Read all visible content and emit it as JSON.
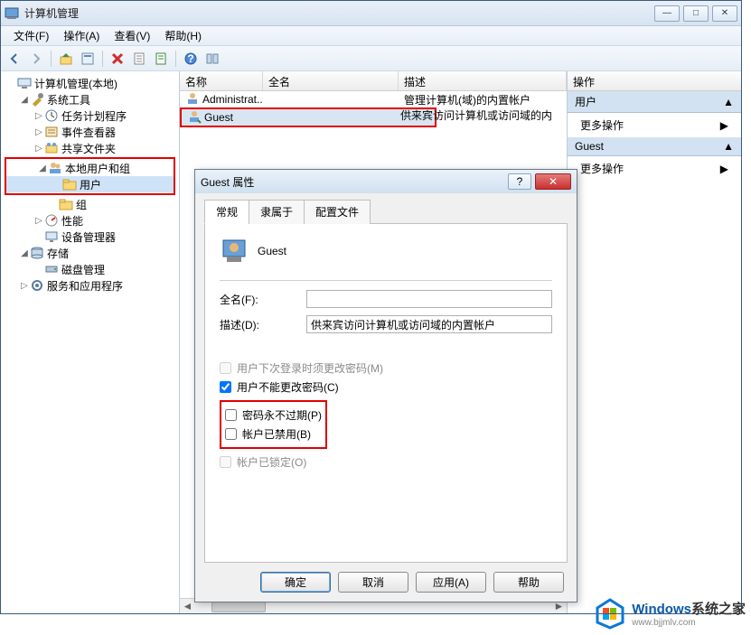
{
  "window": {
    "title": "计算机管理"
  },
  "menu": {
    "file": "文件(F)",
    "action": "操作(A)",
    "view": "查看(V)",
    "help": "帮助(H)"
  },
  "tree": {
    "root": "计算机管理(本地)",
    "sys_tools": "系统工具",
    "task_scheduler": "任务计划程序",
    "event_viewer": "事件查看器",
    "shared_folders": "共享文件夹",
    "local_users_groups": "本地用户和组",
    "users": "用户",
    "groups": "组",
    "performance": "性能",
    "device_manager": "设备管理器",
    "storage": "存储",
    "disk_mgmt": "磁盘管理",
    "services_apps": "服务和应用程序"
  },
  "list": {
    "col_name": "名称",
    "col_fullname": "全名",
    "col_desc": "描述",
    "rows": [
      {
        "name": "Administrat...",
        "fullname": "",
        "desc": "管理计算机(域)的内置帐户"
      },
      {
        "name": "Guest",
        "fullname": "",
        "desc": "供来宾访问计算机或访问域的内"
      }
    ]
  },
  "actions": {
    "header": "操作",
    "group1": "用户",
    "more1": "更多操作",
    "group2": "Guest",
    "more2": "更多操作"
  },
  "dialog": {
    "title": "Guest 属性",
    "tab_general": "常规",
    "tab_member": "隶属于",
    "tab_profile": "配置文件",
    "username": "Guest",
    "fullname_label": "全名(F):",
    "fullname_value": "",
    "desc_label": "描述(D):",
    "desc_value": "供来宾访问计算机或访问域的内置帐户",
    "chk_mustchange": "用户下次登录时须更改密码(M)",
    "chk_cannotchange": "用户不能更改密码(C)",
    "chk_neverexpire": "密码永不过期(P)",
    "chk_disabled": "帐户已禁用(B)",
    "chk_locked": "帐户已锁定(O)",
    "btn_ok": "确定",
    "btn_cancel": "取消",
    "btn_apply": "应用(A)",
    "btn_help": "帮助"
  },
  "watermark": {
    "brand": "Windows",
    "suffix": "系统之家",
    "url": "www.bjjmlv.com"
  }
}
